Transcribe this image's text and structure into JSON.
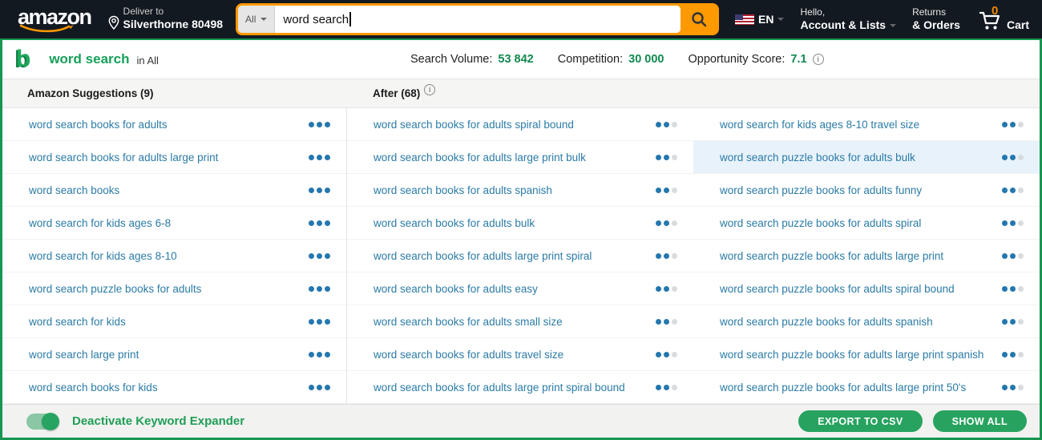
{
  "header": {
    "logo_text": "amazon",
    "deliver_to_label": "Deliver to",
    "deliver_to_location": "Silverthorne 80498",
    "search": {
      "category": "All",
      "value": "word search"
    },
    "language": "EN",
    "account_line1": "Hello,",
    "account_line2": "Account & Lists",
    "orders_line1": "Returns",
    "orders_line2": "& Orders",
    "cart_count": "0",
    "cart_label": "Cart"
  },
  "toolbar": {
    "keyword": "word search",
    "scope": "in All",
    "stats": [
      {
        "label": "Search Volume:",
        "value": "53 842"
      },
      {
        "label": "Competition:",
        "value": "30 000"
      },
      {
        "label": "Opportunity Score:",
        "value": "7.1"
      }
    ],
    "info_icon": "i"
  },
  "table": {
    "col1_header": "Amazon Suggestions (9)",
    "col2_header": "After (68)",
    "columns": [
      {
        "dots": [
          1,
          1,
          1
        ],
        "highlight_index": -1,
        "items": [
          "word search books for adults",
          "word search books for adults large print",
          "word search books",
          "word search for kids ages 6-8",
          "word search for kids ages 8-10",
          "word search puzzle books for adults",
          "word search for kids",
          "word search large print",
          "word search books for kids"
        ]
      },
      {
        "dots": [
          1,
          1,
          0
        ],
        "highlight_index": -1,
        "items": [
          "word search books for adults spiral bound",
          "word search books for adults large print bulk",
          "word search books for adults spanish",
          "word search books for adults bulk",
          "word search books for adults large print spiral",
          "word search books for adults easy",
          "word search books for adults small size",
          "word search books for adults travel size",
          "word search books for adults large print spiral bound"
        ]
      },
      {
        "dots": [
          1,
          1,
          0
        ],
        "highlight_index": 1,
        "items": [
          "word search for kids ages 8-10 travel size",
          "word search puzzle books for adults bulk",
          "word search puzzle books for adults funny",
          "word search puzzle books for adults spiral",
          "word search puzzle books for adults large print",
          "word search puzzle books for adults spiral bound",
          "word search puzzle books for adults spanish",
          "word search puzzle books for adults large print spanish",
          "word search puzzle books for adults large print 50's"
        ]
      }
    ]
  },
  "footer": {
    "toggle_label": "Deactivate Keyword Expander",
    "export_button": "EXPORT TO CSV",
    "show_all_button": "SHOW ALL"
  },
  "colors": {
    "amazon_header_bg": "#131921",
    "amazon_orange": "#ff9900",
    "brand_green": "#1fa85c",
    "stat_green": "#11894f",
    "panel_border_green": "#179551",
    "keyword_blue": "#2b7ba6",
    "dot_blue": "#2477ae",
    "dot_gray": "#d8dcde",
    "highlight_row": "#e8f2fb"
  }
}
